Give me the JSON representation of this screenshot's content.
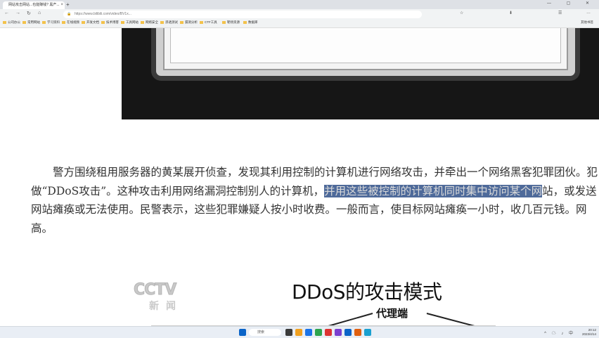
{
  "browser": {
    "tab_title": "网站攻击网站...也能赚钱? 黑产...",
    "tab_close": "×",
    "new_tab": "+",
    "window_controls": "— ▢ ✕",
    "nav_back": "←",
    "nav_forward": "→",
    "nav_reload": "↻",
    "nav_home": "⌂",
    "url": "https://www.bilibili.com/video/BV1x...",
    "extensions": [
      "☆",
      "⬇",
      "☰",
      "…"
    ],
    "bookmarks": [
      "公司办公",
      "常用网站",
      "学习资料",
      "在线视频",
      "开发文档",
      "技术博客",
      "工具网站",
      "网络安全",
      "渗透测试",
      "漏洞分析",
      "CTF工具",
      "靶场资源",
      "数据库"
    ],
    "bookmarks_right": "其他书签"
  },
  "article": {
    "lines": [
      [
        "警方围绕租用服务器的黄某展开侦查，发现其利用控制的计算机进行网络攻击，并牵出一个网络黑客犯罪团伙。犯"
      ],
      [
        "做“DDoS攻击”。这种攻击利用网络漏洞控制别人的计算机，",
        "并用这些被控制的计算机同时集中访问某个网",
        "站，或发送"
      ],
      [
        "网站瘫痪或无法使用。民警表示，这些犯罪嫌疑人按小时收费。一般而言，使目标网站瘫痪一小时，收几百元钱。网"
      ],
      [
        "高。"
      ]
    ]
  },
  "video_frame": {
    "logo": "CCTV",
    "logo_sub": "新闻",
    "title": "DDoS的攻击模式",
    "node_label": "代理端"
  },
  "taskbar": {
    "search_placeholder": "搜索",
    "time": "20:12",
    "date": "2023/4/14",
    "tray_icons": "^ ☁ ♪ 中",
    "icon_colors": [
      "#0a64c8",
      "#3a3a3a",
      "#f0a020",
      "#1a73e8",
      "#2da44e",
      "#d33",
      "#7a3fd0",
      "#0a64c8",
      "#e06010",
      "#1aa0d0"
    ]
  }
}
